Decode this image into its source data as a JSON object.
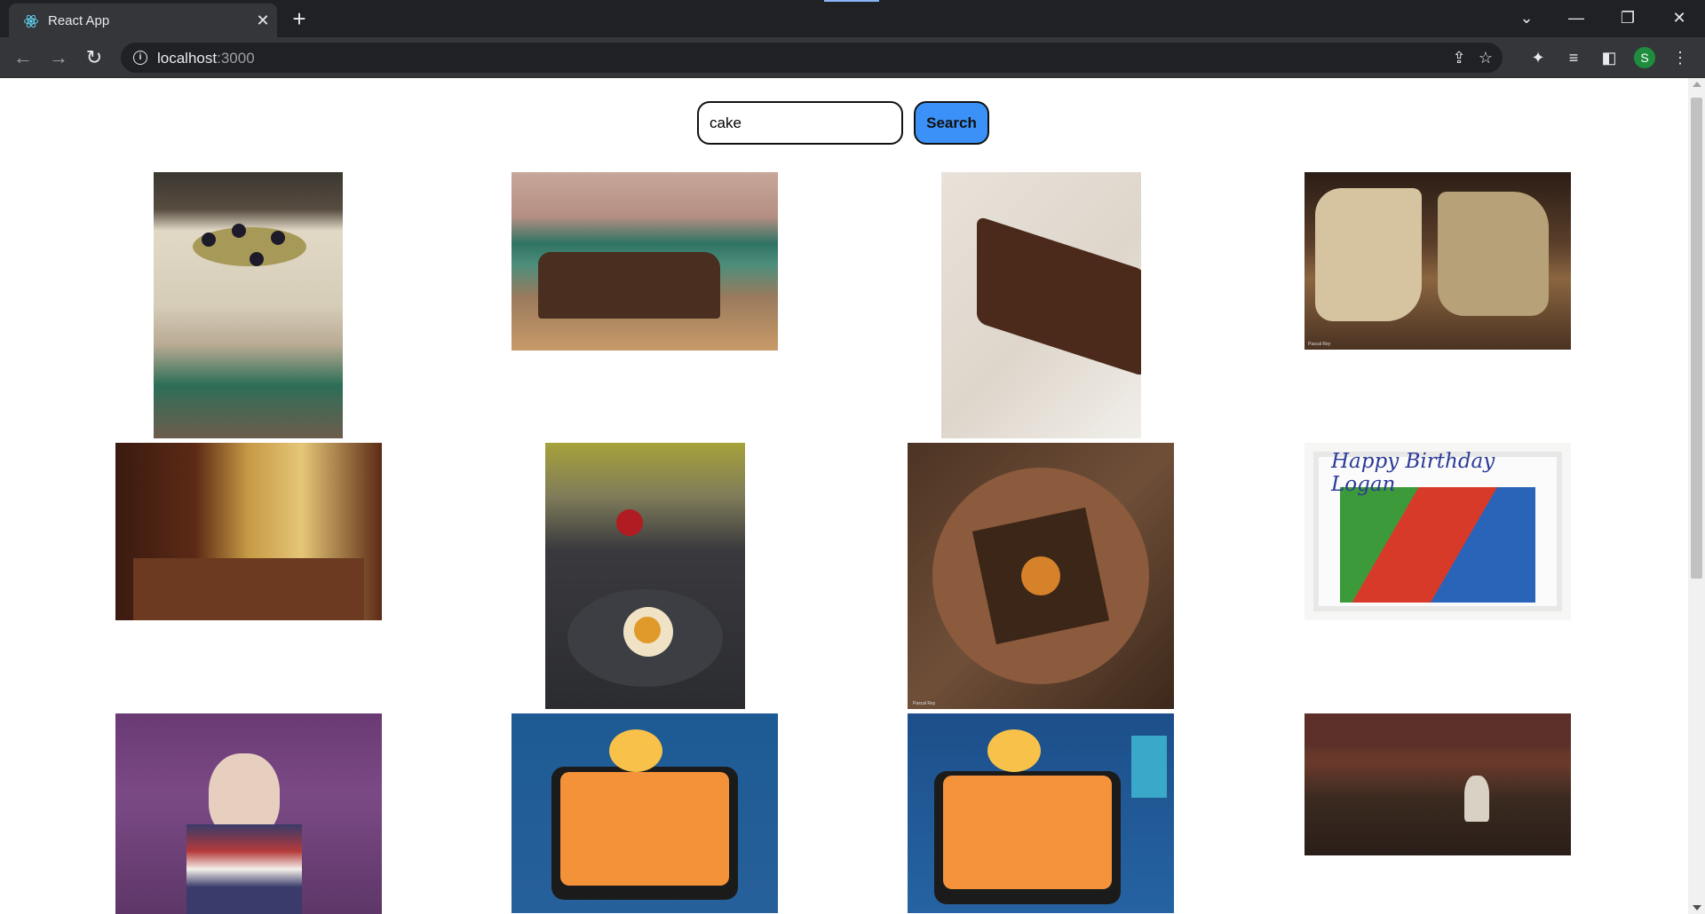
{
  "browser": {
    "tab_title": "React App",
    "url_host": "localhost",
    "url_port": ":3000",
    "profile_initial": "S"
  },
  "search": {
    "query": "cake",
    "button_label": "Search"
  },
  "results": [
    {
      "subject": "layered cake with blackberries"
    },
    {
      "subject": "loaf cake on wooden board"
    },
    {
      "subject": "slice of chocolate cake on plate"
    },
    {
      "subject": "broken pound cake",
      "credit": "Pascal Rey"
    },
    {
      "subject": "family at dinner table"
    },
    {
      "subject": "desserts on plates"
    },
    {
      "subject": "burnt top cake from above",
      "credit": "Pascal Rey"
    },
    {
      "subject": "birthday sheet cake",
      "cake_text": "Happy Birthday Logan"
    },
    {
      "subject": "child with birthday cake"
    },
    {
      "subject": "birthday cake with 22 candles"
    },
    {
      "subject": "birthday cake with 22 candles"
    },
    {
      "subject": "virtual world party scene"
    }
  ]
}
